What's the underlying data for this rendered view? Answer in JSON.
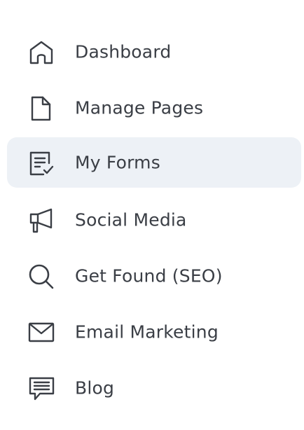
{
  "sidebar": {
    "items": [
      {
        "label": "Dashboard",
        "icon": "home-icon",
        "active": false
      },
      {
        "label": "Manage Pages",
        "icon": "page-icon",
        "active": false
      },
      {
        "label": "My Forms",
        "icon": "form-check-icon",
        "active": true
      },
      {
        "label": "Social Media",
        "icon": "megaphone-icon",
        "active": false
      },
      {
        "label": "Get Found (SEO)",
        "icon": "search-icon",
        "active": false
      },
      {
        "label": "Email Marketing",
        "icon": "envelope-icon",
        "active": false
      },
      {
        "label": "Blog",
        "icon": "message-bubble-icon",
        "active": false
      }
    ]
  },
  "colors": {
    "text": "#3a3e45",
    "icon_stroke": "#3a3e45",
    "active_background": "#edf1f6"
  }
}
